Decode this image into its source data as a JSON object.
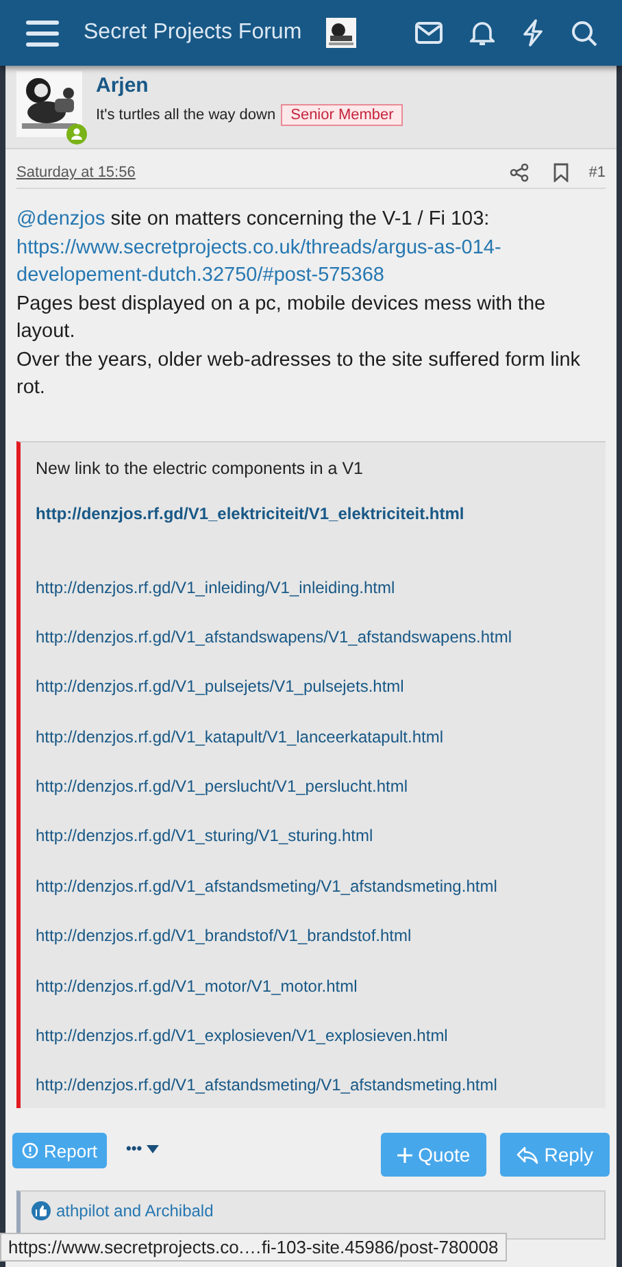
{
  "header": {
    "title": "Secret Projects Forum"
  },
  "post": {
    "author": "Arjen",
    "user_title": "It's turtles all the way down",
    "badge": "Senior Member",
    "online": true,
    "date": "Saturday at 15:56",
    "number": "#1"
  },
  "body": [
    {
      "kind": "sentence",
      "parts": [
        {
          "kind": "mention",
          "text": "@denzjos"
        },
        {
          "kind": "text",
          "text": " site on matters concerning the V-1 / Fi 103:"
        }
      ]
    },
    {
      "kind": "link",
      "text": "https://www.secretprojects.co.uk/threads/argus-as-014-developement-dutch.32750/#post-575368"
    },
    {
      "kind": "text",
      "text": "Pages best displayed on a pc, mobile devices mess with the layout."
    },
    {
      "kind": "text",
      "text": "Over the years, older web-adresses to the site suffered form link rot."
    }
  ],
  "quote": {
    "intro": "New link to the electric components in a V1",
    "main_link": "http://denzjos.rf.gd/V1_elektriciteit/V1_elektriciteit.html",
    "links": [
      "http://denzjos.rf.gd/V1_inleiding/V1_inleiding.html",
      "http://denzjos.rf.gd/V1_afstandswapens/V1_afstandswapens.html",
      "http://denzjos.rf.gd/V1_pulsejets/V1_pulsejets.html",
      "http://denzjos.rf.gd/V1_katapult/V1_lanceerkatapult.html",
      "http://denzjos.rf.gd/V1_perslucht/V1_perslucht.html",
      "http://denzjos.rf.gd/V1_sturing/V1_sturing.html",
      "http://denzjos.rf.gd/V1_afstandsmeting/V1_afstandsmeting.html",
      "http://denzjos.rf.gd/V1_brandstof/V1_brandstof.html",
      "http://denzjos.rf.gd/V1_motor/V1_motor.html",
      "http://denzjos.rf.gd/V1_explosieven/V1_explosieven.html",
      "http://denzjos.rf.gd/V1_afstandsmeting/V1_afstandsmeting.html"
    ]
  },
  "actions": {
    "report": "Report",
    "more": "•••",
    "quote": "Quote",
    "reply": "Reply"
  },
  "likes": "athpilot and Archibald",
  "status_url": "https://www.secretprojects.co.…fi-103-site.45986/post-780008"
}
